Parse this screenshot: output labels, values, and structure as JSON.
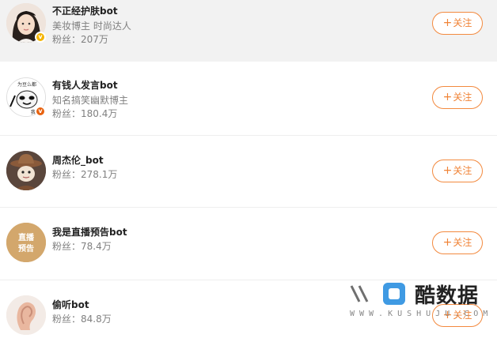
{
  "users": [
    {
      "name": "不正经护肤bot",
      "desc": "美妆博主 时尚达人",
      "fans": "粉丝：207万",
      "follow_label": "关注",
      "follow_icon": "plus-icon",
      "badge_icon": "verified-gold-icon",
      "badge_color": "#f4b400",
      "avatar": "avatar-girl-photo"
    },
    {
      "name": "有钱人发言bot",
      "desc": "知名搞笑幽默博主",
      "fans": "粉丝：180.4万",
      "follow_label": "关注",
      "follow_icon": "plus-icon",
      "badge_icon": "verified-orange-icon",
      "badge_color": "#e8620f",
      "avatar": "avatar-panda-meme"
    },
    {
      "name": "周杰伦_bot",
      "desc": "",
      "fans": "粉丝：278.1万",
      "follow_label": "关注",
      "follow_icon": "plus-icon",
      "avatar": "avatar-cartoon-cowboy"
    },
    {
      "name": "我是直播预告bot",
      "desc": "",
      "fans": "粉丝：78.4万",
      "follow_label": "关注",
      "follow_icon": "plus-icon",
      "avatar": "avatar-live-preview-text",
      "avatar_text": [
        "直播",
        "预告"
      ]
    },
    {
      "name": "偷听bot",
      "desc": "",
      "fans": "粉丝：84.8万",
      "follow_label": "关注",
      "follow_icon": "plus-icon",
      "avatar": "avatar-ear-photo"
    }
  ],
  "watermark": {
    "text": "酷数据",
    "sub": "WWW.KUSHUJU.COM"
  },
  "colors": {
    "accent": "#f08336",
    "hover_row": "#f2f2f2",
    "name": "#222222",
    "muted": "#808080"
  }
}
